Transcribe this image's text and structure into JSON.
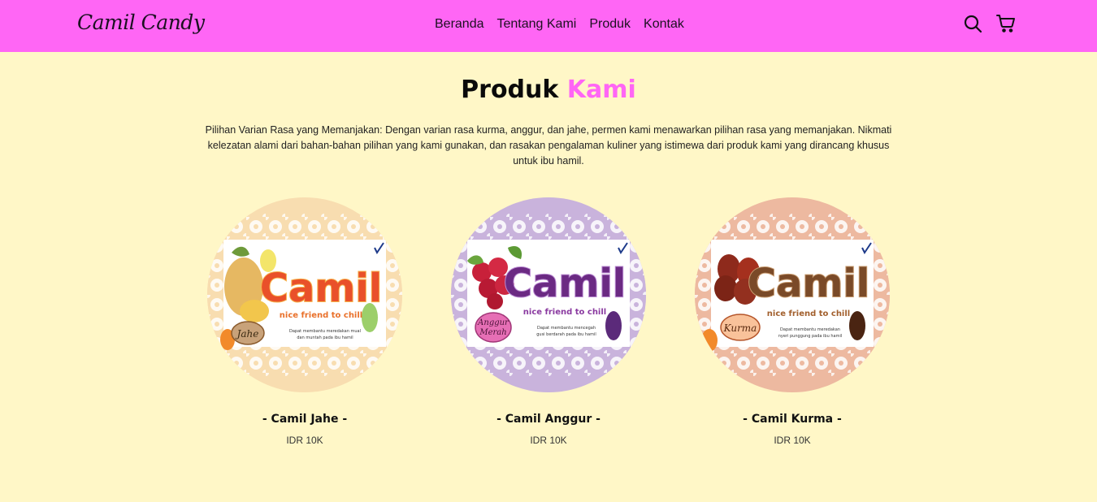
{
  "brand": {
    "logo": "Camil Candy"
  },
  "nav": {
    "links": [
      {
        "label": "Beranda"
      },
      {
        "label": "Tentang Kami"
      },
      {
        "label": "Produk"
      },
      {
        "label": "Kontak"
      }
    ],
    "icons": [
      "search-icon",
      "cart-icon"
    ]
  },
  "section": {
    "title_main": "Produk",
    "title_accent": "Kami",
    "description": "Pilihan Varian Rasa yang Memanjakan: Dengan varian rasa kurma, anggur, dan jahe, permen kami menawarkan pilihan rasa yang memanjakan. Nikmati kelezatan alami dari bahan-bahan pilihan yang kami gunakan, dan rasakan pengalaman kuliner yang istimewa dari produk kami yang dirancang khusus untuk ibu hamil."
  },
  "products": [
    {
      "name": "- Camil Jahe -",
      "price": "IDR 10K",
      "label": {
        "brand": "Camil",
        "tagline": "nice friend to chill",
        "flavor": "Jahe",
        "desc_line1": "Dapat membantu meredakan mual",
        "desc_line2": "dan muntah pada ibu hamil"
      }
    },
    {
      "name": "- Camil Anggur -",
      "price": "IDR 10K",
      "label": {
        "brand": "Camil",
        "tagline": "nice friend to chill",
        "flavor_line1": "Anggur",
        "flavor_line2": "Merah",
        "desc_line1": "Dapat membantu mencegah",
        "desc_line2": "gusi berdarah pada ibu hamil"
      }
    },
    {
      "name": "- Camil Kurma -",
      "price": "IDR 10K",
      "label": {
        "brand": "Camil",
        "tagline": "nice friend to chill",
        "flavor": "Kurma",
        "desc_line1": "Dapat membantu meredakan",
        "desc_line2": "nyeri punggung pada ibu hamil"
      }
    }
  ],
  "colors": {
    "navbar": "#FF66F5",
    "background": "#FFF7C7",
    "accent": "#FF66F5",
    "jahe_bg": "#F8DDB0",
    "anggur_bg": "#C9B3DC",
    "kurma_bg": "#EDB9A0"
  }
}
